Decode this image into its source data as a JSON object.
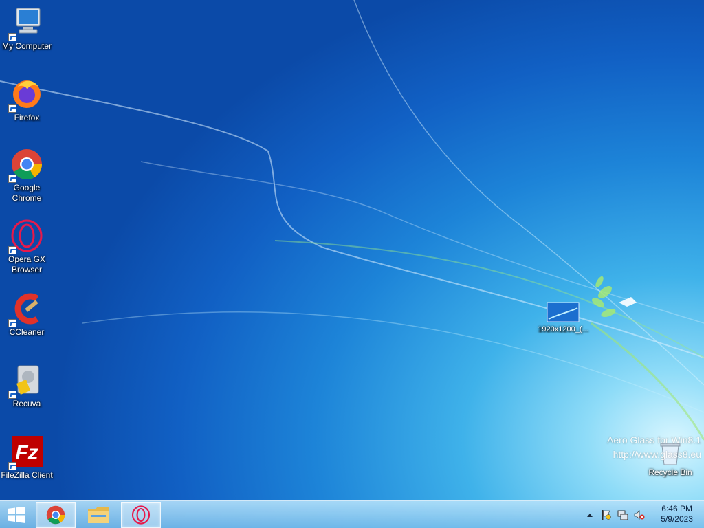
{
  "desktop": {
    "icons": [
      {
        "label": "My Computer"
      },
      {
        "label": "Firefox"
      },
      {
        "label": "Google\nChrome"
      },
      {
        "label": "Opera GX\nBrowser"
      },
      {
        "label": "CCleaner"
      },
      {
        "label": "Recuva"
      },
      {
        "label": "FileZilla Client"
      },
      {
        "label": "1920x1200_(..."
      },
      {
        "label": "Recycle Bin"
      }
    ],
    "watermark": {
      "line1": "Aero Glass for Win8.1",
      "line2": "http://www.glass8.eu"
    }
  },
  "taskbar": {
    "pinned": [
      "chrome-icon",
      "file-explorer-icon",
      "opera-gx-icon"
    ],
    "clock": {
      "time": "6:46 PM",
      "date": "5/9/2023"
    }
  },
  "colors": {
    "accent": "#1d84d8",
    "taskbar": "#86c6ec"
  }
}
